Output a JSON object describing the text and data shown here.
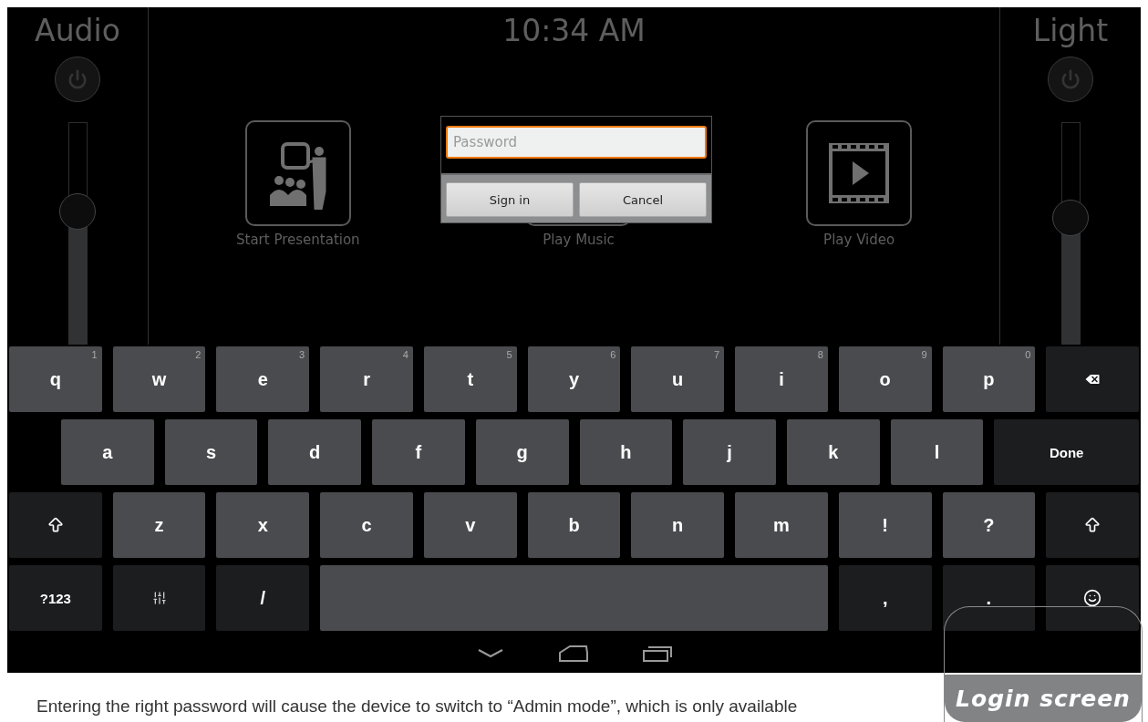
{
  "screen": {
    "clock": "10:34 AM",
    "panels": [
      {
        "title": "Audio",
        "level": 0.6
      },
      {
        "title": "Light",
        "level": 0.57
      }
    ],
    "tiles": [
      {
        "label": "Start Presentation",
        "kind": "presentation"
      },
      {
        "label": "Play Music",
        "kind": "music"
      },
      {
        "label": "Play Video",
        "kind": "video"
      }
    ],
    "dialog": {
      "placeholder": "Password",
      "buttons": [
        "Sign in",
        "Cancel"
      ]
    },
    "keyboard": {
      "rows": [
        {
          "keys": [
            {
              "kind": "letter",
              "label": "q",
              "hint": "1"
            },
            {
              "kind": "letter",
              "label": "w",
              "hint": "2"
            },
            {
              "kind": "letter",
              "label": "e",
              "hint": "3"
            },
            {
              "kind": "letter",
              "label": "r",
              "hint": "4"
            },
            {
              "kind": "letter",
              "label": "t",
              "hint": "5"
            },
            {
              "kind": "letter",
              "label": "y",
              "hint": "6"
            },
            {
              "kind": "letter",
              "label": "u",
              "hint": "7"
            },
            {
              "kind": "letter",
              "label": "i",
              "hint": "8"
            },
            {
              "kind": "letter",
              "label": "o",
              "hint": "9"
            },
            {
              "kind": "letter",
              "label": "p",
              "hint": "0"
            },
            {
              "kind": "backspace"
            }
          ]
        },
        {
          "keys": [
            {
              "kind": "letter",
              "label": "a"
            },
            {
              "kind": "letter",
              "label": "s"
            },
            {
              "kind": "letter",
              "label": "d"
            },
            {
              "kind": "letter",
              "label": "f"
            },
            {
              "kind": "letter",
              "label": "g"
            },
            {
              "kind": "letter",
              "label": "h"
            },
            {
              "kind": "letter",
              "label": "j"
            },
            {
              "kind": "letter",
              "label": "k"
            },
            {
              "kind": "letter",
              "label": "l"
            },
            {
              "kind": "wide",
              "label": "Done"
            }
          ]
        },
        {
          "keys": [
            {
              "kind": "shift"
            },
            {
              "kind": "letter",
              "label": "z"
            },
            {
              "kind": "letter",
              "label": "x"
            },
            {
              "kind": "letter",
              "label": "c"
            },
            {
              "kind": "letter",
              "label": "v"
            },
            {
              "kind": "letter",
              "label": "b"
            },
            {
              "kind": "letter",
              "label": "n"
            },
            {
              "kind": "letter",
              "label": "m"
            },
            {
              "kind": "letter",
              "label": "!"
            },
            {
              "kind": "letter",
              "label": "?"
            },
            {
              "kind": "shift"
            }
          ]
        },
        {
          "keys": [
            {
              "kind": "function",
              "label": "?123"
            },
            {
              "kind": "settings"
            },
            {
              "kind": "function",
              "label": "/"
            },
            {
              "kind": "space"
            },
            {
              "kind": "function",
              "label": ","
            },
            {
              "kind": "function",
              "label": "."
            },
            {
              "kind": "emoji"
            }
          ]
        }
      ]
    }
  },
  "badge": {
    "label": "Login screen"
  },
  "caption": "Entering the right password will cause the device to switch to “Admin mode”, which is only available"
}
